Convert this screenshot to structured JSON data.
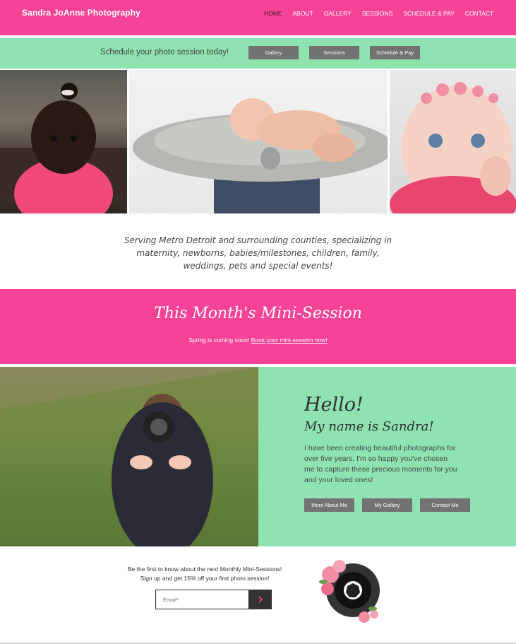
{
  "header": {
    "brand": "Sandra JoAnne Photography",
    "nav": [
      "HOME",
      "ABOUT",
      "GALLERY",
      "SESSIONS",
      "SCHEDULE & PAY",
      "CONTACT"
    ],
    "active": "HOME"
  },
  "strip": {
    "text": "Schedule your photo session today!",
    "buttons": [
      "Gallery",
      "Sessions",
      "Schedule & Pay"
    ]
  },
  "tagline": {
    "lines": [
      "Serving Metro Detroit and surrounding counties, specializing in",
      "maternity, newborns, babies/milestones, children, family,",
      "weddings, pets and special events!"
    ]
  },
  "mini": {
    "title": "This Month's Mini-Session",
    "prefix": "Spring is  coming soon!",
    "link": "Book your mini-session now!"
  },
  "about": {
    "hello": "Hello!",
    "name": "My name is Sandra!",
    "text": "I have been creating beautiful photographs for over five years. I'm so happy you've chosen me to capture these precious moments for you and your loved ones!",
    "buttons": [
      "More About Me",
      "My Gallery",
      "Contact Me"
    ]
  },
  "signup": {
    "line1": "Be the first to know about the next Monthly Mini-Sessions!",
    "line2": "Sign up and get 15% off your first photo session!",
    "placeholder": "Email*"
  },
  "colors": {
    "pink": "#f74397",
    "mint": "#8ee3b0",
    "button_gray": "#727272"
  }
}
